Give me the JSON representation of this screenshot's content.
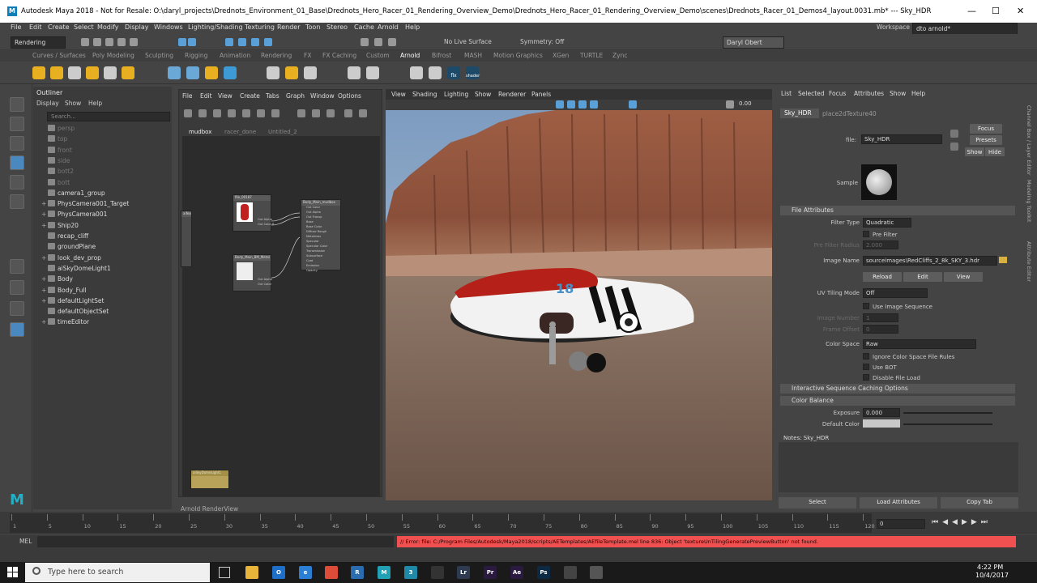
{
  "window": {
    "title": "Autodesk Maya 2018 - Not for Resale: O:\\daryl_projects\\Drednots_Environment_01_Base\\Drednots_Hero_Racer_01_Rendering_Overview_Demo\\Drednots_Hero_Racer_01_Rendering_Overview_Demo\\scenes\\Drednots_Racer_01_Demos4_layout.0031.mb*   ---   Sky_HDR",
    "logo": "M"
  },
  "menubar": [
    "File",
    "Edit",
    "Create",
    "Select",
    "Modify",
    "Display",
    "Windows",
    "Lighting/Shading",
    "Texturing",
    "Render",
    "Toon",
    "Stereo",
    "Cache",
    "Arnold",
    "Help"
  ],
  "workspace": {
    "label": "Workspace :",
    "value": "dto arnold*"
  },
  "statusline": {
    "mode": "Rendering",
    "live_surface": "No Live Surface",
    "symmetry": "Symmetry: Off",
    "user": "Daryl Obert"
  },
  "shelf_tabs": [
    "Curves / Surfaces",
    "Poly Modeling",
    "Sculpting",
    "Rigging",
    "Animation",
    "Rendering",
    "FX",
    "FX Caching",
    "Custom",
    "Arnold",
    "Bifrost",
    "MASH",
    "Motion Graphics",
    "XGen",
    "TURTLE",
    "Zync"
  ],
  "shelf_active": "Arnold",
  "shelf_labels": {
    "flx": "flx",
    "shader": "shader"
  },
  "outliner": {
    "title": "Outliner",
    "menu": [
      "Display",
      "Show",
      "Help"
    ],
    "search_placeholder": "Search...",
    "items": [
      {
        "label": "persp",
        "dim": true,
        "exp": ""
      },
      {
        "label": "top",
        "dim": true,
        "exp": ""
      },
      {
        "label": "front",
        "dim": true,
        "exp": ""
      },
      {
        "label": "side",
        "dim": true,
        "exp": ""
      },
      {
        "label": "bott2",
        "dim": true,
        "exp": ""
      },
      {
        "label": "bott",
        "dim": true,
        "exp": ""
      },
      {
        "label": "camera1_group",
        "dim": false,
        "exp": ""
      },
      {
        "label": "PhysCamera001_Target",
        "dim": false,
        "exp": "+"
      },
      {
        "label": "PhysCamera001",
        "dim": false,
        "exp": "+"
      },
      {
        "label": "Ship20",
        "dim": false,
        "exp": "+"
      },
      {
        "label": "recap_cliff",
        "dim": false,
        "exp": ""
      },
      {
        "label": "groundPlane",
        "dim": false,
        "exp": ""
      },
      {
        "label": "look_dev_prop",
        "dim": false,
        "exp": "+"
      },
      {
        "label": "aiSkyDomeLight1",
        "dim": false,
        "exp": ""
      },
      {
        "label": "Body",
        "dim": false,
        "exp": "+"
      },
      {
        "label": "Body_Full",
        "dim": false,
        "exp": "+"
      },
      {
        "label": "defaultLightSet",
        "dim": false,
        "exp": "+"
      },
      {
        "label": "defaultObjectSet",
        "dim": false,
        "exp": ""
      },
      {
        "label": "timeEditor",
        "dim": false,
        "exp": "+"
      }
    ]
  },
  "node_editor": {
    "menu": [
      "File",
      "Edit",
      "View",
      "Create",
      "Tabs",
      "Graph",
      "Window",
      "Options"
    ],
    "tabs": [
      "mudbox",
      "racer_done",
      "Untitled_2"
    ],
    "active_tab": "mudbox",
    "nodes": {
      "file_top": "file_00187",
      "shader": "Body_Main_mudbox",
      "file_bottom": "Body_Main_BM_Metal",
      "bottom_left": "aiSkyDomeLight1",
      "left_small": "aiNorm"
    },
    "ports": [
      "Out Color",
      "Out Alpha",
      "Out Transp",
      "Base",
      "Base Color",
      "Diffuse Rough",
      "Metalness",
      "Specular",
      "Specular Color",
      "Transmission",
      "Subsurface",
      "Coat",
      "Emission",
      "Opacity"
    ],
    "out_labels": [
      "Out Alpha",
      "Out Color R",
      "Out Color"
    ],
    "panel_label": "Arnold RenderView"
  },
  "viewport": {
    "menu": [
      "View",
      "Shading",
      "Lighting",
      "Show",
      "Renderer",
      "Panels"
    ],
    "readout": "0.00",
    "ship_number": "18"
  },
  "attribute_editor": {
    "menu": [
      "List",
      "Selected",
      "Focus",
      "Attributes",
      "Show",
      "Help"
    ],
    "tabs": [
      "Sky_HDR",
      "place2dTexture40"
    ],
    "file_label": "file:",
    "file_value": "Sky_HDR",
    "buttons": {
      "focus": "Focus",
      "presets": "Presets",
      "show": "Show",
      "hide": "Hide"
    },
    "sample_label": "Sample",
    "sections": {
      "file_attributes": "File Attributes",
      "interactive": "Interactive Sequence Caching Options",
      "color_balance": "Color Balance"
    },
    "filter_type": {
      "label": "Filter Type",
      "value": "Quadratic"
    },
    "pre_filter": "Pre Filter",
    "pre_filter_radius": {
      "label": "Pre Filter Radius",
      "value": "2.000"
    },
    "image_name": {
      "label": "Image Name",
      "value": "sourceimages\\RedCliffs_2_8k_SKY_3.hdr"
    },
    "reload": "Reload",
    "edit": "Edit",
    "view": "View",
    "uv_tiling": {
      "label": "UV Tiling Mode",
      "value": "Off"
    },
    "use_image_sequence": "Use Image Sequence",
    "image_number": {
      "label": "Image Number",
      "value": "1"
    },
    "frame_offset": {
      "label": "Frame Offset",
      "value": "0"
    },
    "color_space": {
      "label": "Color Space",
      "value": "Raw"
    },
    "ignore_cs": "Ignore Color Space File Rules",
    "use_bot": "Use BOT",
    "disable_file_load": "Disable File Load",
    "exposure": {
      "label": "Exposure",
      "value": "0.000"
    },
    "default_color": {
      "label": "Default Color"
    },
    "notes": "Notes:  Sky_HDR",
    "bottom_buttons": [
      "Select",
      "Load Attributes",
      "Copy Tab"
    ]
  },
  "side_labels": [
    "Channel Box / Layer Editor",
    "Modeling Toolkit",
    "Attribute Editor"
  ],
  "timeline": {
    "ticks": [
      "1",
      "5",
      "10",
      "15",
      "20",
      "25",
      "30",
      "35",
      "40",
      "45",
      "50",
      "55",
      "60",
      "65",
      "70",
      "75",
      "80",
      "85",
      "90",
      "95",
      "100",
      "105",
      "110",
      "115",
      "120"
    ],
    "current": "0"
  },
  "command_line": {
    "label": "MEL",
    "error": "// Error: file: C:/Program Files/Autodesk/Maya2018/scripts/AETemplates/AEfileTemplate.mel line 836: Object 'textureUnTilingGeneratePreviewButton' not found."
  },
  "taskbar": {
    "search_placeholder": "Type here to search",
    "apps": [
      {
        "name": "explorer",
        "label": "",
        "color": "#e8b53a"
      },
      {
        "name": "outlook",
        "label": "O",
        "color": "#1e6fc8"
      },
      {
        "name": "edge",
        "label": "e",
        "color": "#2a7fd4"
      },
      {
        "name": "chrome",
        "label": "",
        "color": "#dd4b39"
      },
      {
        "name": "recap",
        "label": "R",
        "color": "#2b6bb0"
      },
      {
        "name": "maya",
        "label": "M",
        "color": "#22a0b5"
      },
      {
        "name": "app3",
        "label": "3",
        "color": "#1f8aa8"
      },
      {
        "name": "unity",
        "label": "",
        "color": "#333333"
      },
      {
        "name": "lightroom",
        "label": "Lr",
        "color": "#2e3a4f"
      },
      {
        "name": "premiere",
        "label": "Pr",
        "color": "#2a1a40"
      },
      {
        "name": "aftereffects",
        "label": "Ae",
        "color": "#2a1a40"
      },
      {
        "name": "photoshop",
        "label": "Ps",
        "color": "#0c2a44"
      },
      {
        "name": "app13",
        "label": "",
        "color": "#444444"
      },
      {
        "name": "app14",
        "label": "",
        "color": "#555555"
      }
    ],
    "time": "4:22 PM",
    "date": "10/4/2017"
  },
  "colors": {
    "accent_blue": "#5aa0d8",
    "error_bar": "#f05050",
    "selected_user": "#555555"
  }
}
